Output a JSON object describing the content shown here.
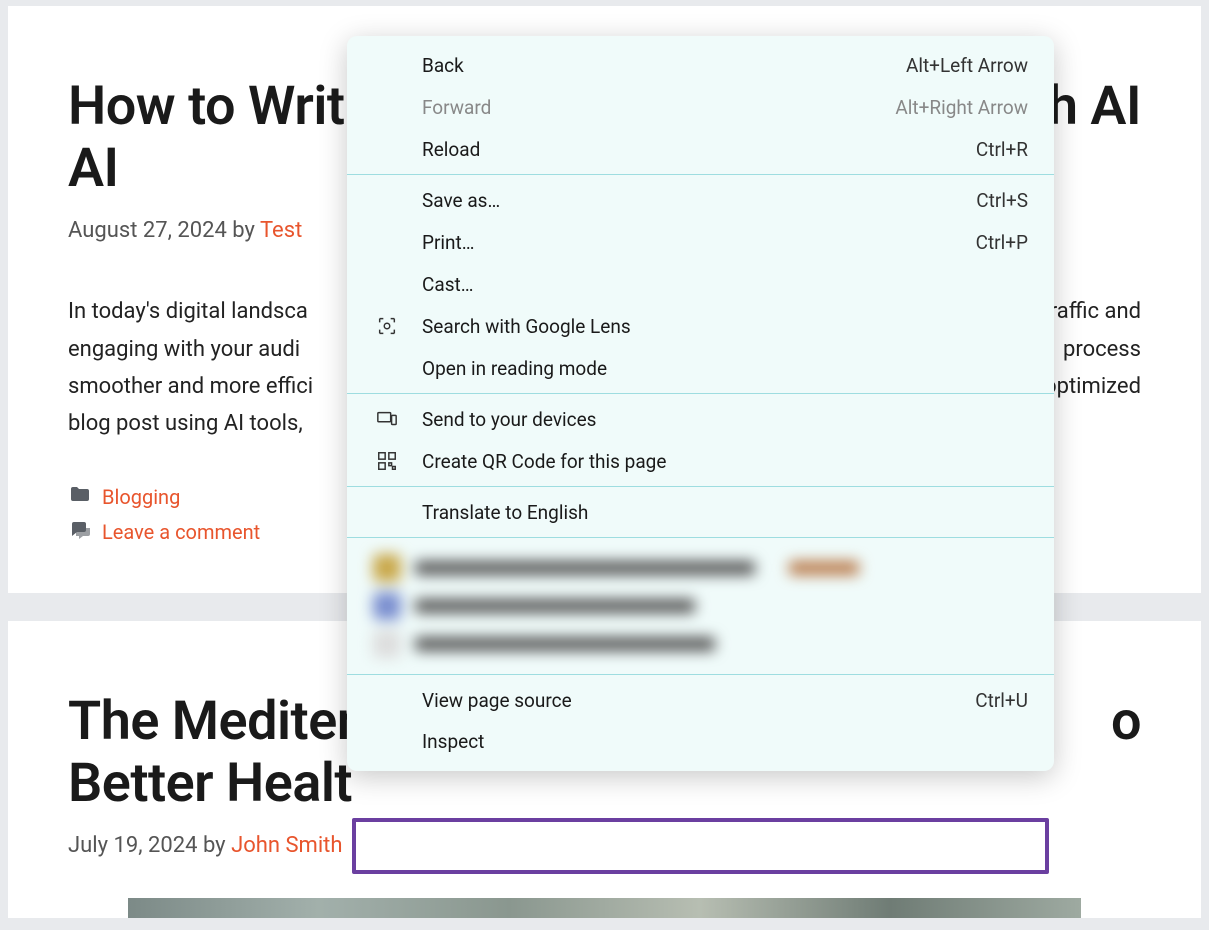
{
  "posts": [
    {
      "title_visible_prefix": "How to Writ",
      "title_visible_suffix": "With AI",
      "date": "August 27, 2024",
      "by": "by",
      "author": "Test",
      "excerpt_prefix": "In today's digital landsca",
      "excerpt_right1": "raffic and",
      "excerpt_line2a": "engaging with your audi",
      "excerpt_right2": "process",
      "excerpt_line3a": "smoother and more effici",
      "excerpt_right3": "-optimized",
      "excerpt_line4": "blog post using AI tools,",
      "category": "Blogging",
      "comment_link": "Leave a comment"
    },
    {
      "title_visible_prefix": "The Mediter",
      "title_visible_suffix": "o",
      "title_line2": "Better Healt",
      "date": "July 19, 2024",
      "by": "by",
      "author": "John Smith"
    }
  ],
  "context_menu": {
    "back": {
      "label": "Back",
      "shortcut": "Alt+Left Arrow"
    },
    "forward": {
      "label": "Forward",
      "shortcut": "Alt+Right Arrow"
    },
    "reload": {
      "label": "Reload",
      "shortcut": "Ctrl+R"
    },
    "save_as": {
      "label": "Save as…",
      "shortcut": "Ctrl+S"
    },
    "print": {
      "label": "Print…",
      "shortcut": "Ctrl+P"
    },
    "cast": {
      "label": "Cast…"
    },
    "lens": {
      "label": "Search with Google Lens"
    },
    "reading": {
      "label": "Open in reading mode"
    },
    "send_devices": {
      "label": "Send to your devices"
    },
    "qr": {
      "label": "Create QR Code for this page"
    },
    "translate": {
      "label": "Translate to English"
    },
    "view_source": {
      "label": "View page source",
      "shortcut": "Ctrl+U"
    },
    "inspect": {
      "label": "Inspect"
    }
  }
}
